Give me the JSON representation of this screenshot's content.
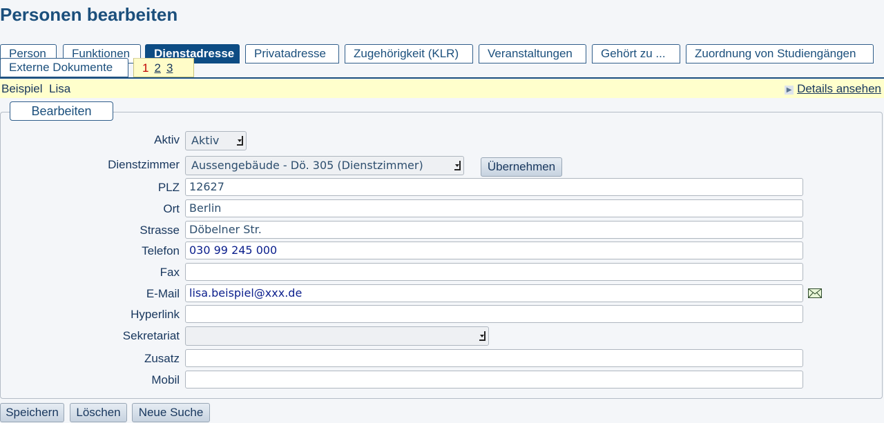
{
  "page_title": "Personen bearbeiten",
  "tabs": [
    {
      "label": "Person"
    },
    {
      "label": "Funktionen"
    },
    {
      "label": "Dienstadresse",
      "active": true
    },
    {
      "label": "Privatadresse"
    },
    {
      "label": "Zugehörigkeit (KLR)"
    },
    {
      "label": "Veranstaltungen"
    },
    {
      "label": "Gehört zu ..."
    },
    {
      "label": "Zuordnung von Studiengängen"
    },
    {
      "label": "Externe Dokumente"
    }
  ],
  "pager": {
    "current": "1",
    "pages": [
      "2",
      "3"
    ]
  },
  "person": {
    "first": "Beispiel",
    "last": "Lisa"
  },
  "details_link": "Details ansehen",
  "section_legend": "Bearbeiten",
  "form": {
    "aktiv": {
      "label": "Aktiv",
      "value": "Aktiv"
    },
    "dienstzimmer": {
      "label": "Dienstzimmer",
      "value": "Aussengebäude - Dö. 305 (Dienstzimmer)",
      "apply_button": "Übernehmen"
    },
    "plz": {
      "label": "PLZ",
      "value": "12627"
    },
    "ort": {
      "label": "Ort",
      "value": "Berlin"
    },
    "strasse": {
      "label": "Strasse",
      "value": "Döbelner Str."
    },
    "telefon": {
      "label": "Telefon",
      "value": "030 99 245 000"
    },
    "fax": {
      "label": "Fax",
      "value": ""
    },
    "email": {
      "label": "E-Mail",
      "value": "lisa.beispiel@xxx.de",
      "icon": "mail-icon"
    },
    "hyperlink": {
      "label": "Hyperlink",
      "value": ""
    },
    "sekretariat": {
      "label": "Sekretariat",
      "value": ""
    },
    "zusatz": {
      "label": "Zusatz",
      "value": ""
    },
    "mobil": {
      "label": "Mobil",
      "value": ""
    }
  },
  "actions": {
    "save": "Speichern",
    "delete": "Löschen",
    "new_search": "Neue Suche"
  }
}
